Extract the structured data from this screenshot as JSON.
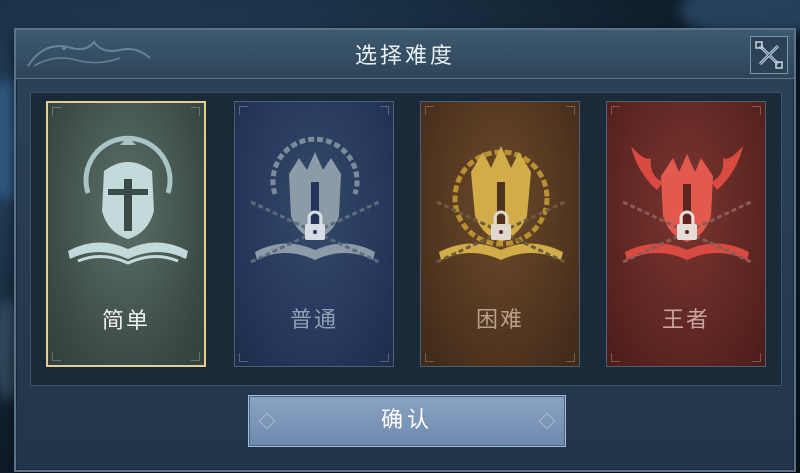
{
  "dialog": {
    "title": "选择难度",
    "close_icon": "close-x-icon"
  },
  "difficulties": [
    {
      "label": "简单",
      "selected": true,
      "locked": false,
      "color": "#b9d3d4",
      "icon": "knight-helmet-icon"
    },
    {
      "label": "普通",
      "selected": false,
      "locked": true,
      "color": "#8d9aa8",
      "icon": "spiked-helmet-icon"
    },
    {
      "label": "困难",
      "selected": false,
      "locked": true,
      "color": "#c9a441",
      "icon": "crowned-helmet-icon"
    },
    {
      "label": "王者",
      "selected": false,
      "locked": true,
      "color": "#d94a40",
      "icon": "horned-helmet-icon"
    }
  ],
  "confirm_label": "确认",
  "colors": {
    "selected_border": "#e5cf8e",
    "confirm_bg": "#7d97ba"
  }
}
